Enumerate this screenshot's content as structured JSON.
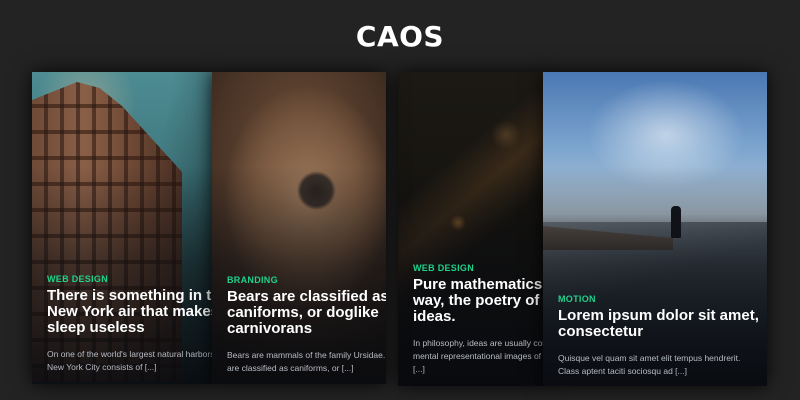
{
  "page": {
    "title": "CAOS"
  },
  "cards": [
    {
      "category": "WEB DESIGN",
      "title": "There is something in the\nNew York air that makes\nsleep useless",
      "excerpt": "On one of the world's largest natural harbors,\nNew York City consists of [...]"
    },
    {
      "category": "BRANDING",
      "title": "Bears are classified as\ncaniforms, or doglike\ncarnivorans",
      "excerpt": "Bears are mammals of the family Ursidae. Bears\nare classified as caniforms, or [...]"
    },
    {
      "category": "WEB DESIGN",
      "title": "Pure mathematics is, in its\nway, the poetry of logical\nideas.",
      "excerpt": "In philosophy, ideas are usually construed as\nmental representational images of some object\n[...]"
    },
    {
      "category": "MOTION",
      "title": "Lorem ipsum dolor sit amet,\nconsectetur",
      "excerpt": "Quisque vel quam sit amet elit tempus hendrerit.\nClass aptent taciti sociosqu ad [...]"
    }
  ]
}
